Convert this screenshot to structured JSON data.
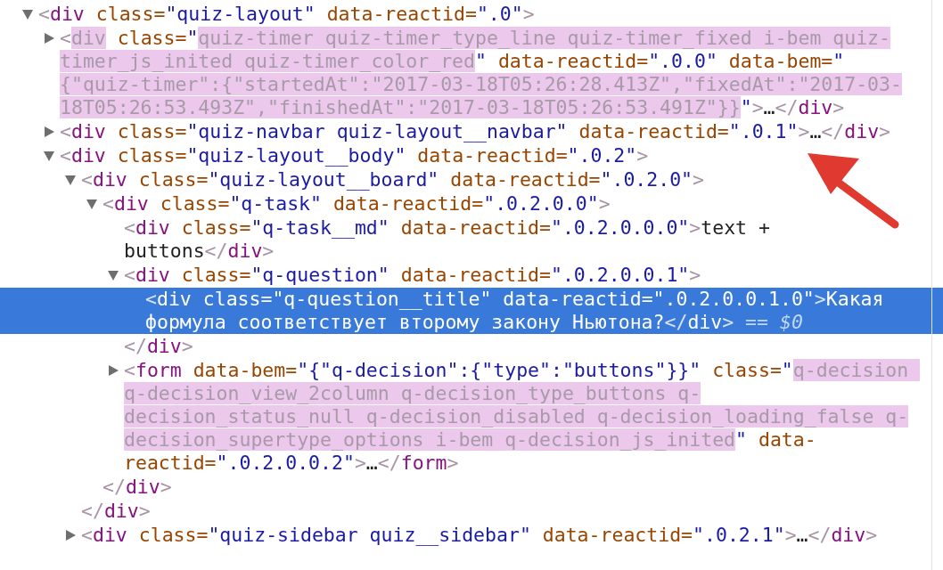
{
  "tree": [
    {
      "expanded": true,
      "selected": false,
      "tokens": [
        {
          "kind": "punct",
          "s": "<"
        },
        {
          "kind": "tag",
          "s": "div"
        },
        {
          "kind": "attr",
          "s": " class="
        },
        {
          "kind": "value",
          "s": "\"quiz-layout\""
        },
        {
          "kind": "attr",
          "s": " data-reactid="
        },
        {
          "kind": "value",
          "s": "\".0\""
        },
        {
          "kind": "punct",
          "s": ">"
        }
      ],
      "children": [
        {
          "expanded": false,
          "selected": false,
          "tokens": [
            {
              "kind": "punct",
              "s": "<"
            },
            {
              "kind": "highlight",
              "s": "div"
            },
            {
              "kind": "attr",
              "s": " class="
            },
            {
              "kind": "value",
              "s": "\""
            },
            {
              "kind": "highlight",
              "s": "quiz-timer quiz-timer_type_line quiz-timer_fixed i-bem quiz-timer_js_inited quiz-timer_color_red"
            },
            {
              "kind": "value",
              "s": "\""
            },
            {
              "kind": "attr",
              "s": " data-reactid="
            },
            {
              "kind": "value",
              "s": "\".0.0\""
            },
            {
              "kind": "attr",
              "s": " data-bem="
            },
            {
              "kind": "value",
              "s": "\""
            },
            {
              "kind": "highlight",
              "s": "{\"quiz-timer\":{\"startedAt\":\"2017-03-18T05:26:28.413Z\",\"fixedAt\":\"2017-03-18T05:26:53.493Z\",\"finishedAt\":\"2017-03-18T05:26:53.491Z\"}}"
            },
            {
              "kind": "value",
              "s": "\""
            },
            {
              "kind": "punct",
              "s": ">"
            },
            {
              "kind": "text",
              "s": "…"
            },
            {
              "kind": "punct",
              "s": "</"
            },
            {
              "kind": "tag",
              "s": "div"
            },
            {
              "kind": "punct",
              "s": ">"
            }
          ]
        },
        {
          "expanded": false,
          "selected": false,
          "tokens": [
            {
              "kind": "punct",
              "s": "<"
            },
            {
              "kind": "tag",
              "s": "div"
            },
            {
              "kind": "attr",
              "s": " class="
            },
            {
              "kind": "value",
              "s": "\"quiz-navbar quiz-layout__navbar\""
            },
            {
              "kind": "attr",
              "s": " data-reactid="
            },
            {
              "kind": "value",
              "s": "\".0.1\""
            },
            {
              "kind": "punct",
              "s": ">"
            },
            {
              "kind": "text",
              "s": "…"
            },
            {
              "kind": "punct",
              "s": "</"
            },
            {
              "kind": "tag",
              "s": "div"
            },
            {
              "kind": "punct",
              "s": ">"
            }
          ]
        },
        {
          "expanded": true,
          "selected": false,
          "tokens": [
            {
              "kind": "punct",
              "s": "<"
            },
            {
              "kind": "tag",
              "s": "div"
            },
            {
              "kind": "attr",
              "s": " class="
            },
            {
              "kind": "value",
              "s": "\"quiz-layout__body\""
            },
            {
              "kind": "attr",
              "s": " data-reactid="
            },
            {
              "kind": "value",
              "s": "\".0.2\""
            },
            {
              "kind": "punct",
              "s": ">"
            }
          ],
          "children": [
            {
              "expanded": true,
              "selected": false,
              "tokens": [
                {
                  "kind": "punct",
                  "s": "<"
                },
                {
                  "kind": "tag",
                  "s": "div"
                },
                {
                  "kind": "attr",
                  "s": " class="
                },
                {
                  "kind": "value",
                  "s": "\"quiz-layout__board\""
                },
                {
                  "kind": "attr",
                  "s": " data-reactid="
                },
                {
                  "kind": "value",
                  "s": "\".0.2.0\""
                },
                {
                  "kind": "punct",
                  "s": ">"
                }
              ],
              "close": [
                {
                  "kind": "punct",
                  "s": "</"
                },
                {
                  "kind": "tag",
                  "s": "div"
                },
                {
                  "kind": "punct",
                  "s": ">"
                }
              ],
              "children": [
                {
                  "expanded": true,
                  "selected": false,
                  "tokens": [
                    {
                      "kind": "punct",
                      "s": "<"
                    },
                    {
                      "kind": "tag",
                      "s": "div"
                    },
                    {
                      "kind": "attr",
                      "s": " class="
                    },
                    {
                      "kind": "value",
                      "s": "\"q-task\""
                    },
                    {
                      "kind": "attr",
                      "s": " data-reactid="
                    },
                    {
                      "kind": "value",
                      "s": "\".0.2.0.0\""
                    },
                    {
                      "kind": "punct",
                      "s": ">"
                    }
                  ],
                  "close": [
                    {
                      "kind": "punct",
                      "s": "</"
                    },
                    {
                      "kind": "tag",
                      "s": "div"
                    },
                    {
                      "kind": "punct",
                      "s": ">"
                    }
                  ],
                  "children": [
                    {
                      "selected": false,
                      "tokens": [
                        {
                          "kind": "punct",
                          "s": "<"
                        },
                        {
                          "kind": "tag",
                          "s": "div"
                        },
                        {
                          "kind": "attr",
                          "s": " class="
                        },
                        {
                          "kind": "value",
                          "s": "\"q-task__md\""
                        },
                        {
                          "kind": "attr",
                          "s": " data-reactid="
                        },
                        {
                          "kind": "value",
                          "s": "\".0.2.0.0.0\""
                        },
                        {
                          "kind": "punct",
                          "s": ">"
                        },
                        {
                          "kind": "text",
                          "s": "text + buttons"
                        },
                        {
                          "kind": "punct",
                          "s": "</"
                        },
                        {
                          "kind": "tag",
                          "s": "div"
                        },
                        {
                          "kind": "punct",
                          "s": ">"
                        }
                      ]
                    },
                    {
                      "expanded": true,
                      "selected": false,
                      "tokens": [
                        {
                          "kind": "punct",
                          "s": "<"
                        },
                        {
                          "kind": "tag",
                          "s": "div"
                        },
                        {
                          "kind": "attr",
                          "s": " class="
                        },
                        {
                          "kind": "value",
                          "s": "\"q-question\""
                        },
                        {
                          "kind": "attr",
                          "s": " data-reactid="
                        },
                        {
                          "kind": "value",
                          "s": "\".0.2.0.0.1\""
                        },
                        {
                          "kind": "punct",
                          "s": ">"
                        }
                      ],
                      "close": [
                        {
                          "kind": "punct",
                          "s": "</"
                        },
                        {
                          "kind": "tag",
                          "s": "div"
                        },
                        {
                          "kind": "punct",
                          "s": ">"
                        }
                      ],
                      "children": [
                        {
                          "selected": true,
                          "tokens": [
                            {
                              "kind": "punct",
                              "s": "<"
                            },
                            {
                              "kind": "tag",
                              "s": "div"
                            },
                            {
                              "kind": "attr",
                              "s": " class="
                            },
                            {
                              "kind": "value",
                              "s": "\"q-question__title\""
                            },
                            {
                              "kind": "attr",
                              "s": " data-reactid="
                            },
                            {
                              "kind": "value",
                              "s": "\".0.2.0.0.1.0\""
                            },
                            {
                              "kind": "punct",
                              "s": ">"
                            },
                            {
                              "kind": "text",
                              "s": "Какая формула соответствует второму закону Ньютона?"
                            },
                            {
                              "kind": "punct",
                              "s": "</"
                            },
                            {
                              "kind": "tag",
                              "s": "div"
                            },
                            {
                              "kind": "punct",
                              "s": ">"
                            },
                            {
                              "kind": "ref",
                              "s": " == $0"
                            }
                          ]
                        }
                      ]
                    },
                    {
                      "expanded": false,
                      "selected": false,
                      "tokens": [
                        {
                          "kind": "punct",
                          "s": "<"
                        },
                        {
                          "kind": "tag",
                          "s": "form"
                        },
                        {
                          "kind": "attr",
                          "s": " data-bem="
                        },
                        {
                          "kind": "value",
                          "s": "\"{\"q-decision\":{\"type\":\"buttons\"}}\""
                        },
                        {
                          "kind": "attr",
                          "s": " class="
                        },
                        {
                          "kind": "value",
                          "s": "\""
                        },
                        {
                          "kind": "highlight",
                          "s": "q-decision q-decision_view_2column q-decision_type_buttons q-decision_status_null q-decision_disabled q-decision_loading_false q-decision_supertype_options i-bem q-decision_js_inited"
                        },
                        {
                          "kind": "value",
                          "s": "\""
                        },
                        {
                          "kind": "attr",
                          "s": " data-reactid="
                        },
                        {
                          "kind": "value",
                          "s": "\".0.2.0.0.2\""
                        },
                        {
                          "kind": "punct",
                          "s": ">"
                        },
                        {
                          "kind": "text",
                          "s": "…"
                        },
                        {
                          "kind": "punct",
                          "s": "</"
                        },
                        {
                          "kind": "tag",
                          "s": "form"
                        },
                        {
                          "kind": "punct",
                          "s": ">"
                        }
                      ]
                    }
                  ]
                }
              ]
            },
            {
              "expanded": false,
              "selected": false,
              "tokens": [
                {
                  "kind": "punct",
                  "s": "<"
                },
                {
                  "kind": "tag",
                  "s": "div"
                },
                {
                  "kind": "attr",
                  "s": " class="
                },
                {
                  "kind": "value",
                  "s": "\"quiz-sidebar quiz__sidebar\""
                },
                {
                  "kind": "attr",
                  "s": " data-reactid="
                },
                {
                  "kind": "value",
                  "s": "\".0.2.1\""
                },
                {
                  "kind": "punct",
                  "s": ">"
                },
                {
                  "kind": "text",
                  "s": "…"
                },
                {
                  "kind": "punct",
                  "s": "</"
                },
                {
                  "kind": "tag",
                  "s": "div"
                },
                {
                  "kind": "punct",
                  "s": ">"
                }
              ]
            }
          ]
        }
      ]
    }
  ]
}
